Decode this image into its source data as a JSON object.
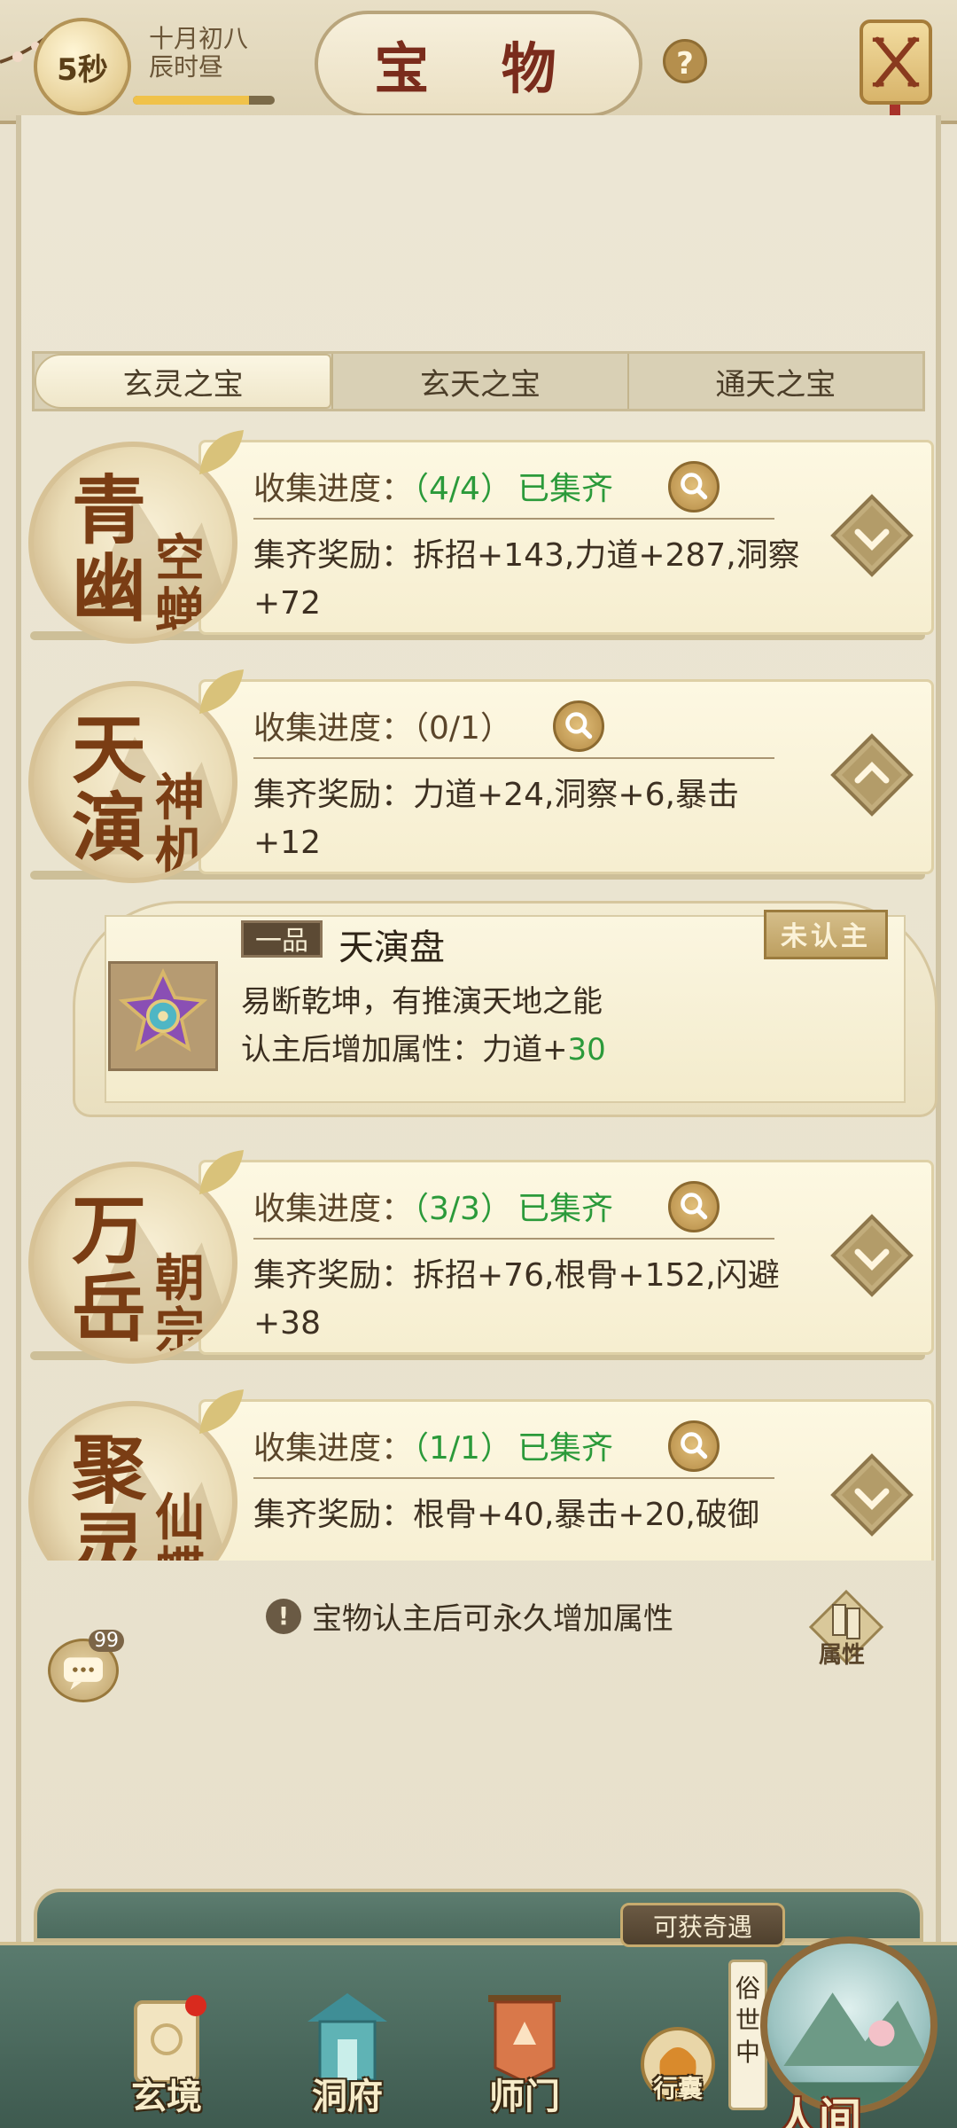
{
  "header": {
    "timer": "5秒",
    "lunar_date": "十月初八",
    "lunar_time": "辰时昼",
    "time_progress": 0.82,
    "title": "宝 物",
    "help": "?"
  },
  "tabs": [
    {
      "label": "玄灵之宝",
      "active": true
    },
    {
      "label": "玄天之宝",
      "active": false
    },
    {
      "label": "通天之宝",
      "active": false
    }
  ],
  "sets": [
    {
      "name_big": "青幽",
      "name_small": "空蝉",
      "progress_label": "收集进度：",
      "progress_count": "（4/4）",
      "complete_text": "已集齐",
      "reward_label": "集齐奖励：",
      "reward": "拆招+143,力道+287,洞察+72",
      "expanded": false
    },
    {
      "name_big": "天演",
      "name_small": "神机",
      "progress_label": "收集进度：",
      "progress_count": "（0/1）",
      "complete_text": "",
      "reward_label": "集齐奖励：",
      "reward": "力道+24,洞察+6,暴击+12",
      "expanded": true
    },
    {
      "name_big": "万岳",
      "name_small": "朝宗",
      "progress_label": "收集进度：",
      "progress_count": "（3/3）",
      "complete_text": "已集齐",
      "reward_label": "集齐奖励：",
      "reward": "拆招+76,根骨+152,闪避+38",
      "expanded": false
    },
    {
      "name_big": "聚灵",
      "name_small": "仙蝶",
      "progress_label": "收集进度：",
      "progress_count": "（1/1）",
      "complete_text": "已集齐",
      "reward_label": "集齐奖励：",
      "reward": "根骨+40,暴击+20,破御",
      "expanded": false
    }
  ],
  "detail": {
    "grade": "一品",
    "item_name": "天演盘",
    "status": "未认主",
    "description": "易断乾坤，有推演天地之能",
    "attr_label": "认主后增加属性：力道+",
    "attr_value": "30"
  },
  "hint": "宝物认主后可永久增加属性",
  "chat_badge": "99",
  "attr_button": "属性",
  "nav": {
    "items": [
      "玄境",
      "洞府",
      "师门",
      "行囊"
    ],
    "adventure": "可获奇遇",
    "secular": "俗世中",
    "world": "人间"
  },
  "colors": {
    "accent_green": "#2b9a3a",
    "title_red": "#7a2c1c",
    "nav_green": "#4c6b5e"
  }
}
